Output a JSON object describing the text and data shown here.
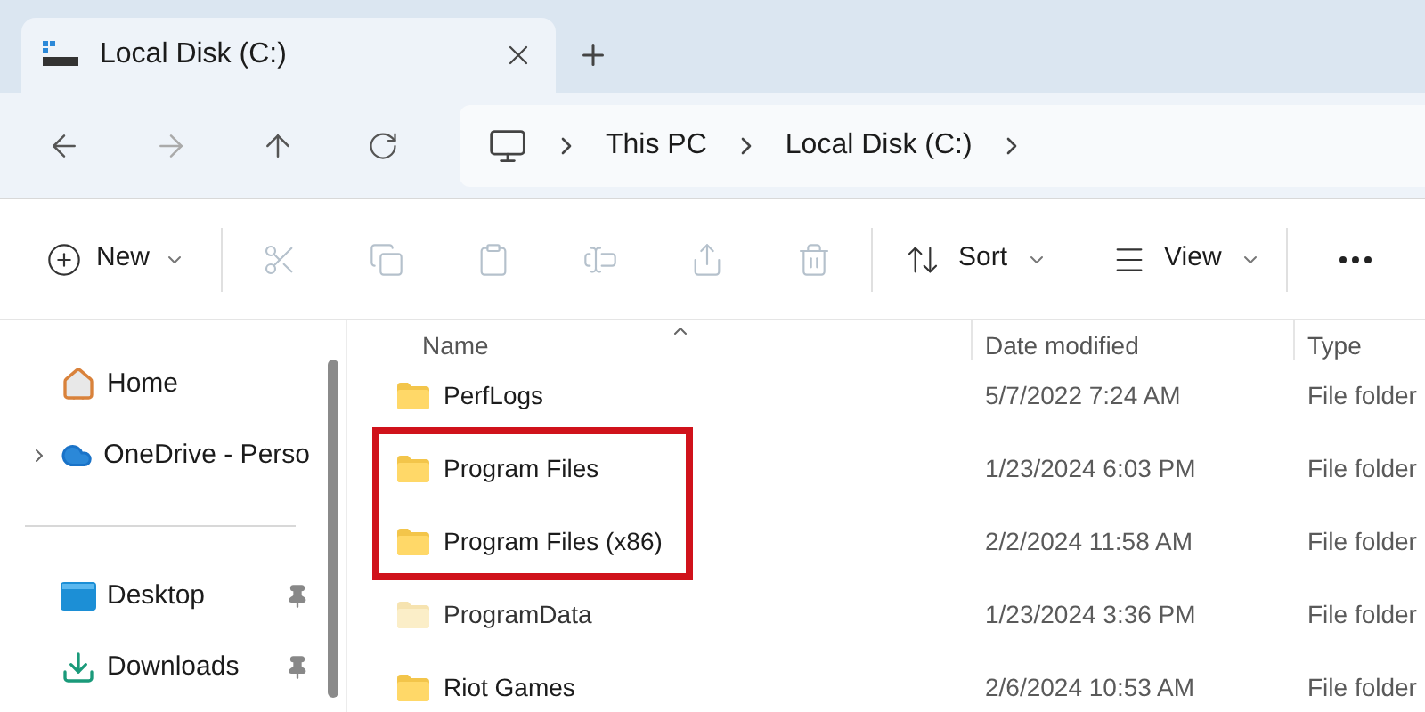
{
  "tabs": [
    {
      "label": "Local Disk (C:)",
      "selected": true
    }
  ],
  "address": {
    "crumbs": [
      "This PC",
      "Local Disk (C:)"
    ]
  },
  "toolbar": {
    "new_label": "New",
    "sort_label": "Sort",
    "view_label": "View"
  },
  "sidebar": {
    "items": [
      {
        "label": "Home",
        "kind": "home",
        "expandable": false,
        "pinned": false
      },
      {
        "label": "OneDrive - Perso",
        "kind": "cloud",
        "expandable": true,
        "pinned": false
      },
      {
        "kind": "divider"
      },
      {
        "label": "Desktop",
        "kind": "desktop",
        "expandable": false,
        "pinned": true
      },
      {
        "label": "Downloads",
        "kind": "download",
        "expandable": false,
        "pinned": true
      }
    ]
  },
  "table": {
    "columns": [
      "Name",
      "Date modified",
      "Type"
    ],
    "rows": [
      {
        "name": "PerfLogs",
        "date": "5/7/2022 7:24 AM",
        "type": "File folder",
        "hidden": false,
        "highlighted": false
      },
      {
        "name": "Program Files",
        "date": "1/23/2024 6:03 PM",
        "type": "File folder",
        "hidden": false,
        "highlighted": true
      },
      {
        "name": "Program Files (x86)",
        "date": "2/2/2024 11:58 AM",
        "type": "File folder",
        "hidden": false,
        "highlighted": true
      },
      {
        "name": "ProgramData",
        "date": "1/23/2024 3:36 PM",
        "type": "File folder",
        "hidden": true,
        "highlighted": false
      },
      {
        "name": "Riot Games",
        "date": "2/6/2024 10:53 AM",
        "type": "File folder",
        "hidden": false,
        "highlighted": false
      }
    ]
  }
}
